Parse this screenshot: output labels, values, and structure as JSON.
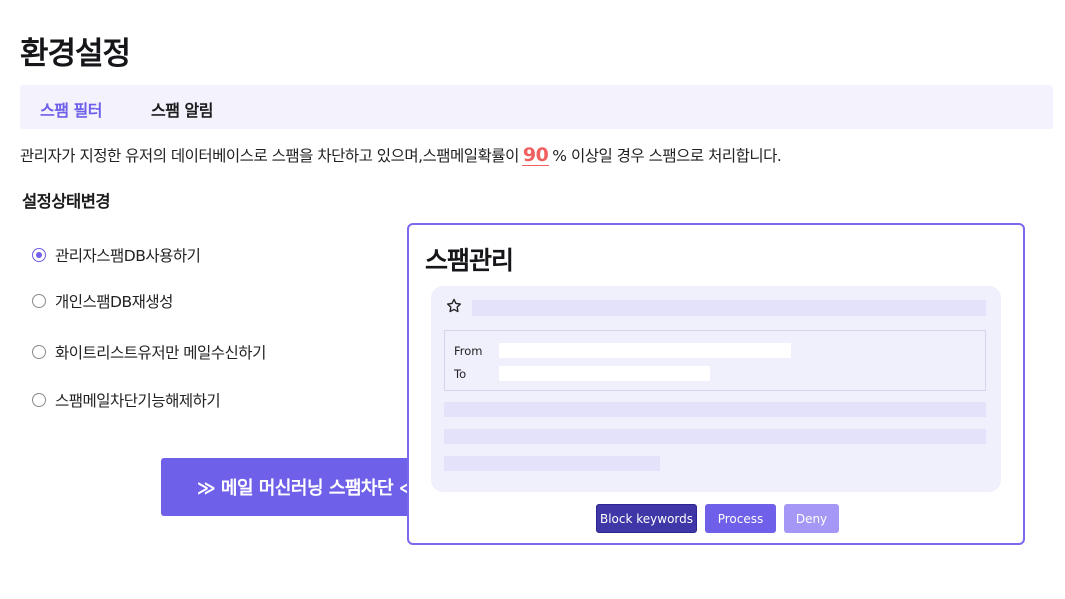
{
  "page": {
    "title": "환경설정"
  },
  "tabs": [
    {
      "label": "스팸 필터",
      "active": true
    },
    {
      "label": "스팸 알림",
      "active": false
    }
  ],
  "description": {
    "before": "관리자가 지정한 유저의 데이터베이스로 스팸을 차단하고 있으며,스팸메일확률이",
    "probability": "90",
    "after": "% 이상일 경우 스팸으로 처리합니다."
  },
  "settings": {
    "title": "설정상태변경",
    "options": [
      {
        "label": "관리자스팸DB사용하기",
        "checked": true
      },
      {
        "label": "개인스팸DB재생성",
        "checked": false
      },
      {
        "label": "화이트리스트유저만 메일수신하기",
        "checked": false
      },
      {
        "label": "스팸메일차단기능해제하기",
        "checked": false
      }
    ]
  },
  "ml_button": {
    "label": "≫ 메일 머신러닝 스팸차단 ≪"
  },
  "spam_panel": {
    "title": "스팸관리",
    "from_label": "From",
    "to_label": "To",
    "actions": {
      "block_keywords": "Block keywords",
      "process": "Process",
      "deny": "Deny"
    }
  },
  "colors": {
    "accent": "#6e60e9",
    "accent_dark": "#3f36a8",
    "accent_light": "#a597f5",
    "highlight": "#f06060",
    "tab_bg": "#f3f2fd",
    "preview_bg": "#f0effc"
  }
}
